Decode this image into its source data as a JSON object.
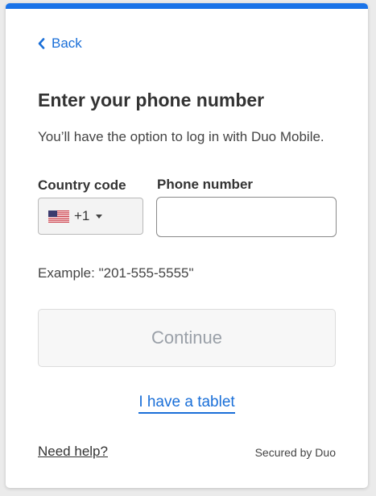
{
  "back": {
    "label": "Back"
  },
  "header": {
    "title": "Enter your phone number",
    "subtitle": "You’ll have the option to log in with Duo Mobile."
  },
  "form": {
    "country_label": "Country code",
    "country_value": "+1",
    "country_flag": "us-flag-icon",
    "phone_label": "Phone number",
    "phone_value": "",
    "example": "Example: \"201-555-5555\""
  },
  "continue_label": "Continue",
  "tablet_link": "I have a tablet",
  "footer": {
    "help": "Need help?",
    "secured": "Secured by Duo"
  },
  "colors": {
    "accent": "#1a73e8",
    "link": "#1a6fd8",
    "disabled_text": "#9aa0a8"
  }
}
